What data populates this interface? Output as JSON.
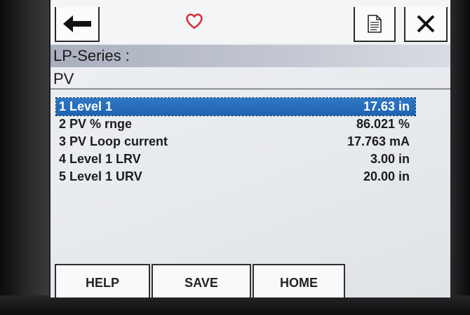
{
  "toolbar": {
    "back_icon": "arrow-left-icon",
    "favorite_icon": "heart-icon",
    "document_icon": "document-icon",
    "close_icon": "close-icon"
  },
  "header": {
    "title": "LP-Series   :",
    "subtitle": "PV"
  },
  "list": {
    "items": [
      {
        "label": "1 Level 1",
        "value": "17.63 in"
      },
      {
        "label": "2 PV % rnge",
        "value": "86.021 %"
      },
      {
        "label": "3 PV Loop current",
        "value": "17.763 mA"
      },
      {
        "label": "4 Level 1 LRV",
        "value": "3.00 in"
      },
      {
        "label": "5 Level 1 URV",
        "value": "20.00 in"
      }
    ]
  },
  "tabs": {
    "help": "HELP",
    "save": "SAVE",
    "home": "HOME"
  },
  "colors": {
    "selection": "#1f63b0",
    "heart": "#d9343f",
    "title_bar": "#b7bcc8"
  }
}
